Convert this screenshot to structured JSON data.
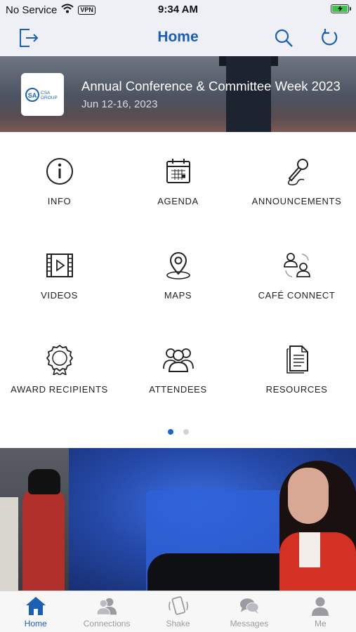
{
  "status_bar": {
    "carrier": "No Service",
    "vpn": "VPN",
    "time": "9:34 AM"
  },
  "nav": {
    "title": "Home",
    "accent": "#1a5fb4",
    "left_icon": "logout-icon",
    "right_icons": [
      "search-icon",
      "refresh-icon"
    ]
  },
  "event": {
    "logo_text": "CSA GROUP",
    "title": "Annual Conference & Committee Week 2023",
    "date": "Jun 12-16, 2023"
  },
  "grid": {
    "items": [
      {
        "label": "INFO",
        "icon": "info-icon"
      },
      {
        "label": "AGENDA",
        "icon": "calendar-icon"
      },
      {
        "label": "ANNOUNCEMENTS",
        "icon": "microphone-icon"
      },
      {
        "label": "VIDEOS",
        "icon": "video-icon"
      },
      {
        "label": "MAPS",
        "icon": "map-pin-icon"
      },
      {
        "label": "CAFÉ CONNECT",
        "icon": "people-connect-icon"
      },
      {
        "label": "AWARD RECIPIENTS",
        "icon": "award-icon"
      },
      {
        "label": "ATTENDEES",
        "icon": "attendees-icon"
      },
      {
        "label": "RESOURCES",
        "icon": "document-icon"
      }
    ],
    "page_count": 2,
    "active_page": 1
  },
  "tabs": [
    {
      "label": "Home",
      "icon": "home-icon",
      "active": true
    },
    {
      "label": "Connections",
      "icon": "connections-icon",
      "active": false
    },
    {
      "label": "Shake",
      "icon": "shake-icon",
      "active": false
    },
    {
      "label": "Messages",
      "icon": "messages-icon",
      "active": false
    },
    {
      "label": "Me",
      "icon": "person-icon",
      "active": false
    }
  ]
}
